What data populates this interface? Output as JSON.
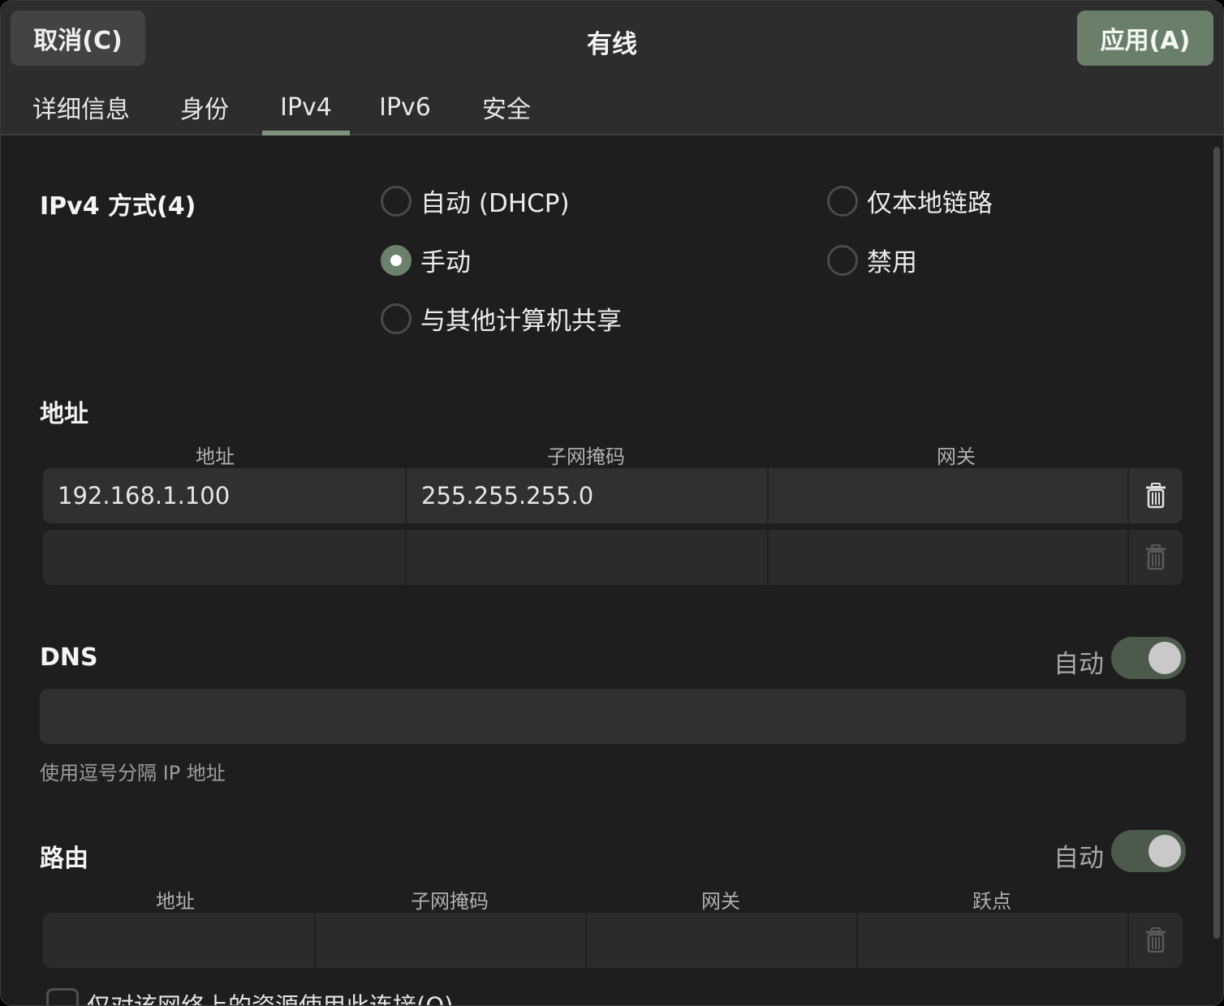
{
  "header": {
    "cancel_label": "取消(C)",
    "title": "有线",
    "apply_label": "应用(A)"
  },
  "tabs": [
    {
      "label": "详细信息",
      "active": false
    },
    {
      "label": "身份",
      "active": false
    },
    {
      "label": "IPv4",
      "active": true
    },
    {
      "label": "IPv6",
      "active": false
    },
    {
      "label": "安全",
      "active": false
    }
  ],
  "method": {
    "title": "IPv4 方式(4)",
    "options": [
      {
        "label": "自动 (DHCP)",
        "checked": false
      },
      {
        "label": "仅本地链路",
        "checked": false
      },
      {
        "label": "手动",
        "checked": true
      },
      {
        "label": "禁用",
        "checked": false
      },
      {
        "label": "与其他计算机共享",
        "checked": false
      }
    ]
  },
  "addresses": {
    "title": "地址",
    "columns": [
      "地址",
      "子网掩码",
      "网关"
    ],
    "rows": [
      [
        "192.168.1.100",
        "255.255.255.0",
        ""
      ],
      [
        "",
        "",
        ""
      ]
    ]
  },
  "dns": {
    "title": "DNS",
    "auto_label": "自动",
    "auto_enabled": true,
    "value": "",
    "hint": "使用逗号分隔 IP 地址"
  },
  "routes": {
    "title": "路由",
    "auto_label": "自动",
    "auto_enabled": true,
    "columns": [
      "地址",
      "子网掩码",
      "网关",
      "跃点"
    ],
    "rows": [
      [
        "",
        "",
        "",
        ""
      ]
    ]
  },
  "bottom_checkbox": {
    "label": "仅对该网络上的资源使用此连接(O)",
    "checked": false
  },
  "colors": {
    "accent": "#6a7f6a",
    "tab_indicator": "#7e947e",
    "background": "#1e1e1e"
  }
}
